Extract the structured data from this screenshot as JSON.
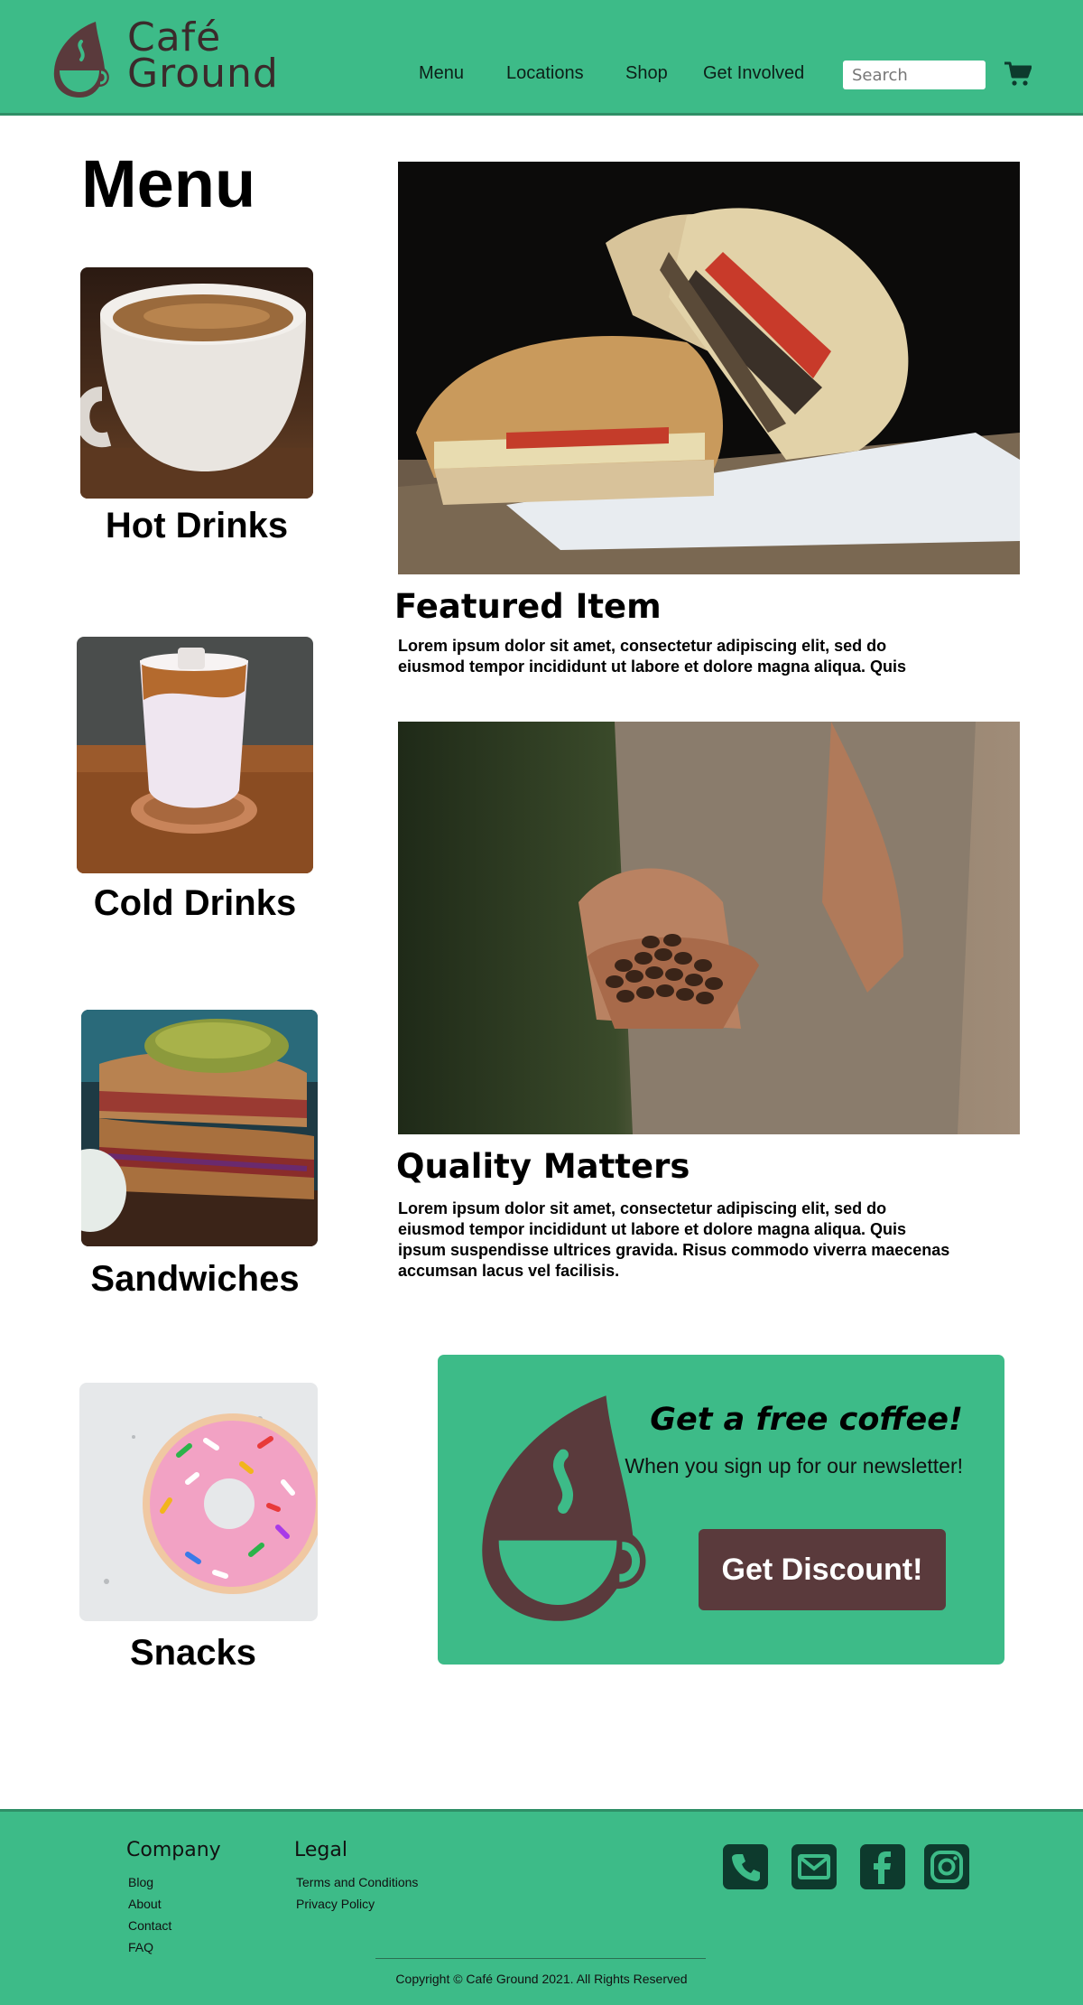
{
  "brand": {
    "name_line1": "Café",
    "name_line2": "Ground",
    "logo_icon": "coffee-cup-drop-logo"
  },
  "nav": {
    "items": [
      {
        "label": "Menu"
      },
      {
        "label": "Locations"
      },
      {
        "label": "Shop"
      },
      {
        "label": "Get Involved"
      }
    ],
    "search_placeholder": "Search",
    "cart_icon": "shopping-cart-icon"
  },
  "menu": {
    "title": "Menu",
    "categories": [
      {
        "label": "Hot Drinks",
        "image": "hot-coffee-cup-photo"
      },
      {
        "label": "Cold Drinks",
        "image": "iced-latte-photo"
      },
      {
        "label": "Sandwiches",
        "image": "sandwich-with-pickle-photo"
      },
      {
        "label": "Snacks",
        "image": "sprinkle-donut-photo"
      }
    ]
  },
  "featured": {
    "title": "Featured Item",
    "body": "Lorem ipsum dolor sit amet, consectetur adipiscing elit, sed do eiusmod tempor incididunt ut labore et dolore magna aliqua. Quis",
    "image": "grilled-panini-photo"
  },
  "quality": {
    "title": "Quality Matters",
    "body": "Lorem ipsum dolor sit amet, consectetur adipiscing elit, sed do eiusmod tempor incididunt ut labore et dolore magna aliqua. Quis ipsum suspendisse ultrices gravida. Risus commodo viverra maecenas accumsan lacus vel facilisis.",
    "image": "hands-holding-coffee-beans-photo"
  },
  "promo": {
    "title": "Get a free coffee!",
    "subtitle": "When you sign up for our newsletter!",
    "button_label": "Get Discount!"
  },
  "footer": {
    "company": {
      "title": "Company",
      "links": [
        "Blog",
        "About",
        "Contact",
        "FAQ"
      ]
    },
    "legal": {
      "title": "Legal",
      "links": [
        "Terms and Conditions",
        "Privacy Policy"
      ]
    },
    "social_icons": [
      "phone-icon",
      "email-icon",
      "facebook-icon",
      "instagram-icon"
    ],
    "copyright": "Copyright © Café Ground 2021. All Rights Reserved"
  },
  "colors": {
    "brand_green": "#3dbb88",
    "brand_brown": "#5a3a3c",
    "dark_green": "#0d3a2d"
  }
}
